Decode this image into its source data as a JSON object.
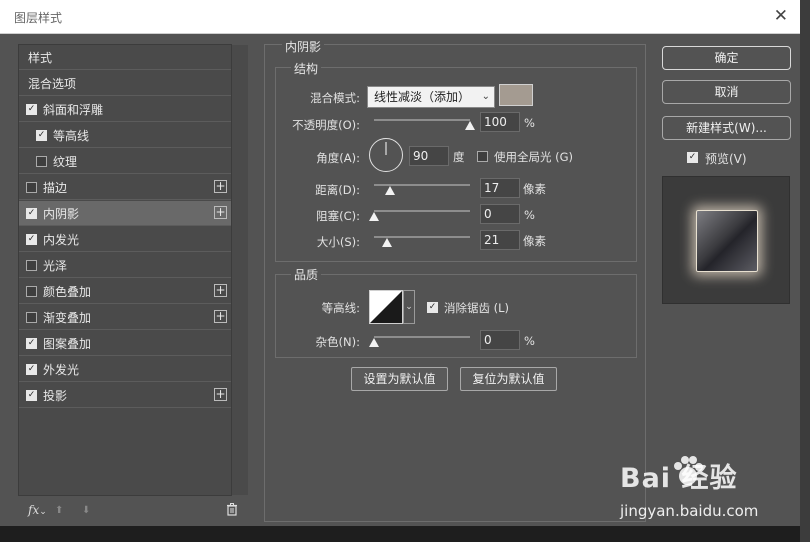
{
  "window": {
    "title": "图层样式",
    "close_glyph": "✕"
  },
  "left_list": {
    "items": [
      {
        "label": "样式",
        "checkbox": null,
        "plus": false,
        "indent": 0,
        "selected": false
      },
      {
        "label": "混合选项",
        "checkbox": null,
        "plus": false,
        "indent": 0,
        "selected": false
      },
      {
        "label": "斜面和浮雕",
        "checkbox": true,
        "plus": false,
        "indent": 0,
        "selected": false
      },
      {
        "label": "等高线",
        "checkbox": true,
        "plus": false,
        "indent": 1,
        "selected": false
      },
      {
        "label": "纹理",
        "checkbox": false,
        "plus": false,
        "indent": 1,
        "selected": false
      },
      {
        "label": "描边",
        "checkbox": false,
        "plus": true,
        "indent": 0,
        "selected": false
      },
      {
        "label": "内阴影",
        "checkbox": true,
        "plus": true,
        "indent": 0,
        "selected": true
      },
      {
        "label": "内发光",
        "checkbox": true,
        "plus": false,
        "indent": 0,
        "selected": false
      },
      {
        "label": "光泽",
        "checkbox": false,
        "plus": false,
        "indent": 0,
        "selected": false
      },
      {
        "label": "颜色叠加",
        "checkbox": false,
        "plus": true,
        "indent": 0,
        "selected": false
      },
      {
        "label": "渐变叠加",
        "checkbox": false,
        "plus": true,
        "indent": 0,
        "selected": false
      },
      {
        "label": "图案叠加",
        "checkbox": true,
        "plus": false,
        "indent": 0,
        "selected": false
      },
      {
        "label": "外发光",
        "checkbox": true,
        "plus": false,
        "indent": 0,
        "selected": false
      },
      {
        "label": "投影",
        "checkbox": true,
        "plus": true,
        "indent": 0,
        "selected": false
      }
    ],
    "footer": {
      "fx": "fx",
      "up_glyph": "⬆",
      "down_glyph": "⬇",
      "trash_glyph": "🗑"
    }
  },
  "inner_shadow": {
    "panel_title": "内阴影",
    "structure": {
      "title": "结构",
      "blend_mode_label": "混合模式:",
      "blend_mode_value": "线性减淡（添加）",
      "shadow_color": "#a49b91",
      "opacity_label": "不透明度(O):",
      "opacity_value": "100",
      "opacity_unit": "%",
      "opacity_level": 1.0,
      "angle_label": "角度(A):",
      "angle_value": "90",
      "angle_unit": "度",
      "global_light_label": "使用全局光 (G)",
      "global_light_checked": false,
      "distance_label": "距离(D):",
      "distance_value": "17",
      "distance_unit": "像素",
      "distance_level": 0.17,
      "choke_label": "阻塞(C):",
      "choke_value": "0",
      "choke_unit": "%",
      "choke_level": 0.0,
      "size_label": "大小(S):",
      "size_value": "21",
      "size_unit": "像素",
      "size_level": 0.14
    },
    "quality": {
      "title": "品质",
      "contour_label": "等高线:",
      "antialias_label": "消除锯齿 (L)",
      "antialias_checked": true,
      "noise_label": "杂色(N):",
      "noise_value": "0",
      "noise_unit": "%",
      "noise_level": 0.0
    },
    "make_default_label": "设置为默认值",
    "reset_default_label": "复位为默认值"
  },
  "right": {
    "ok_label": "确定",
    "cancel_label": "取消",
    "new_style_label": "新建样式(W)...",
    "preview_label": "预览(V)",
    "preview_checked": true
  },
  "watermark": {
    "brand": "Bai  经验",
    "url": "jingyan.baidu.com"
  }
}
